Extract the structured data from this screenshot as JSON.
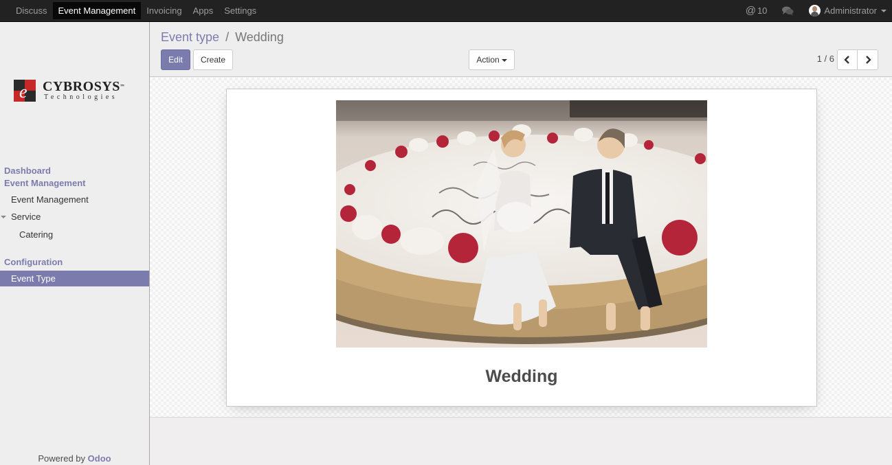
{
  "topbar": {
    "menu": [
      {
        "label": "Discuss",
        "active": false
      },
      {
        "label": "Event Management",
        "active": true
      },
      {
        "label": "Invoicing",
        "active": false
      },
      {
        "label": "Apps",
        "active": false
      },
      {
        "label": "Settings",
        "active": false
      }
    ],
    "mentions_symbol": "@",
    "mentions_count": "10",
    "chat_icon": "chat-bubbles-icon",
    "user_name": "Administrator"
  },
  "sidebar": {
    "logo": {
      "name": "CYBROSYS",
      "tm": "™",
      "tagline": "Technologies"
    },
    "sections": [
      {
        "label": "Dashboard"
      },
      {
        "label": "Event Management"
      }
    ],
    "items": [
      {
        "label": "Event Management"
      },
      {
        "label": "Service"
      },
      {
        "label": "Catering"
      }
    ],
    "config_section": "Configuration",
    "active_item": "Event Type",
    "powered_prefix": "Powered by",
    "powered_brand": "Odoo"
  },
  "control_panel": {
    "breadcrumb_parent": "Event type",
    "breadcrumb_sep": "/",
    "breadcrumb_current": "Wedding",
    "edit_label": "Edit",
    "create_label": "Create",
    "action_label": "Action",
    "pager_value": "1 / 6"
  },
  "record": {
    "image_alt": "Wedding cake with bride and groom figurines",
    "name": "Wedding"
  },
  "colors": {
    "brand": "#7c7bad",
    "topbar": "#222222",
    "topbar_active": "#080808"
  }
}
